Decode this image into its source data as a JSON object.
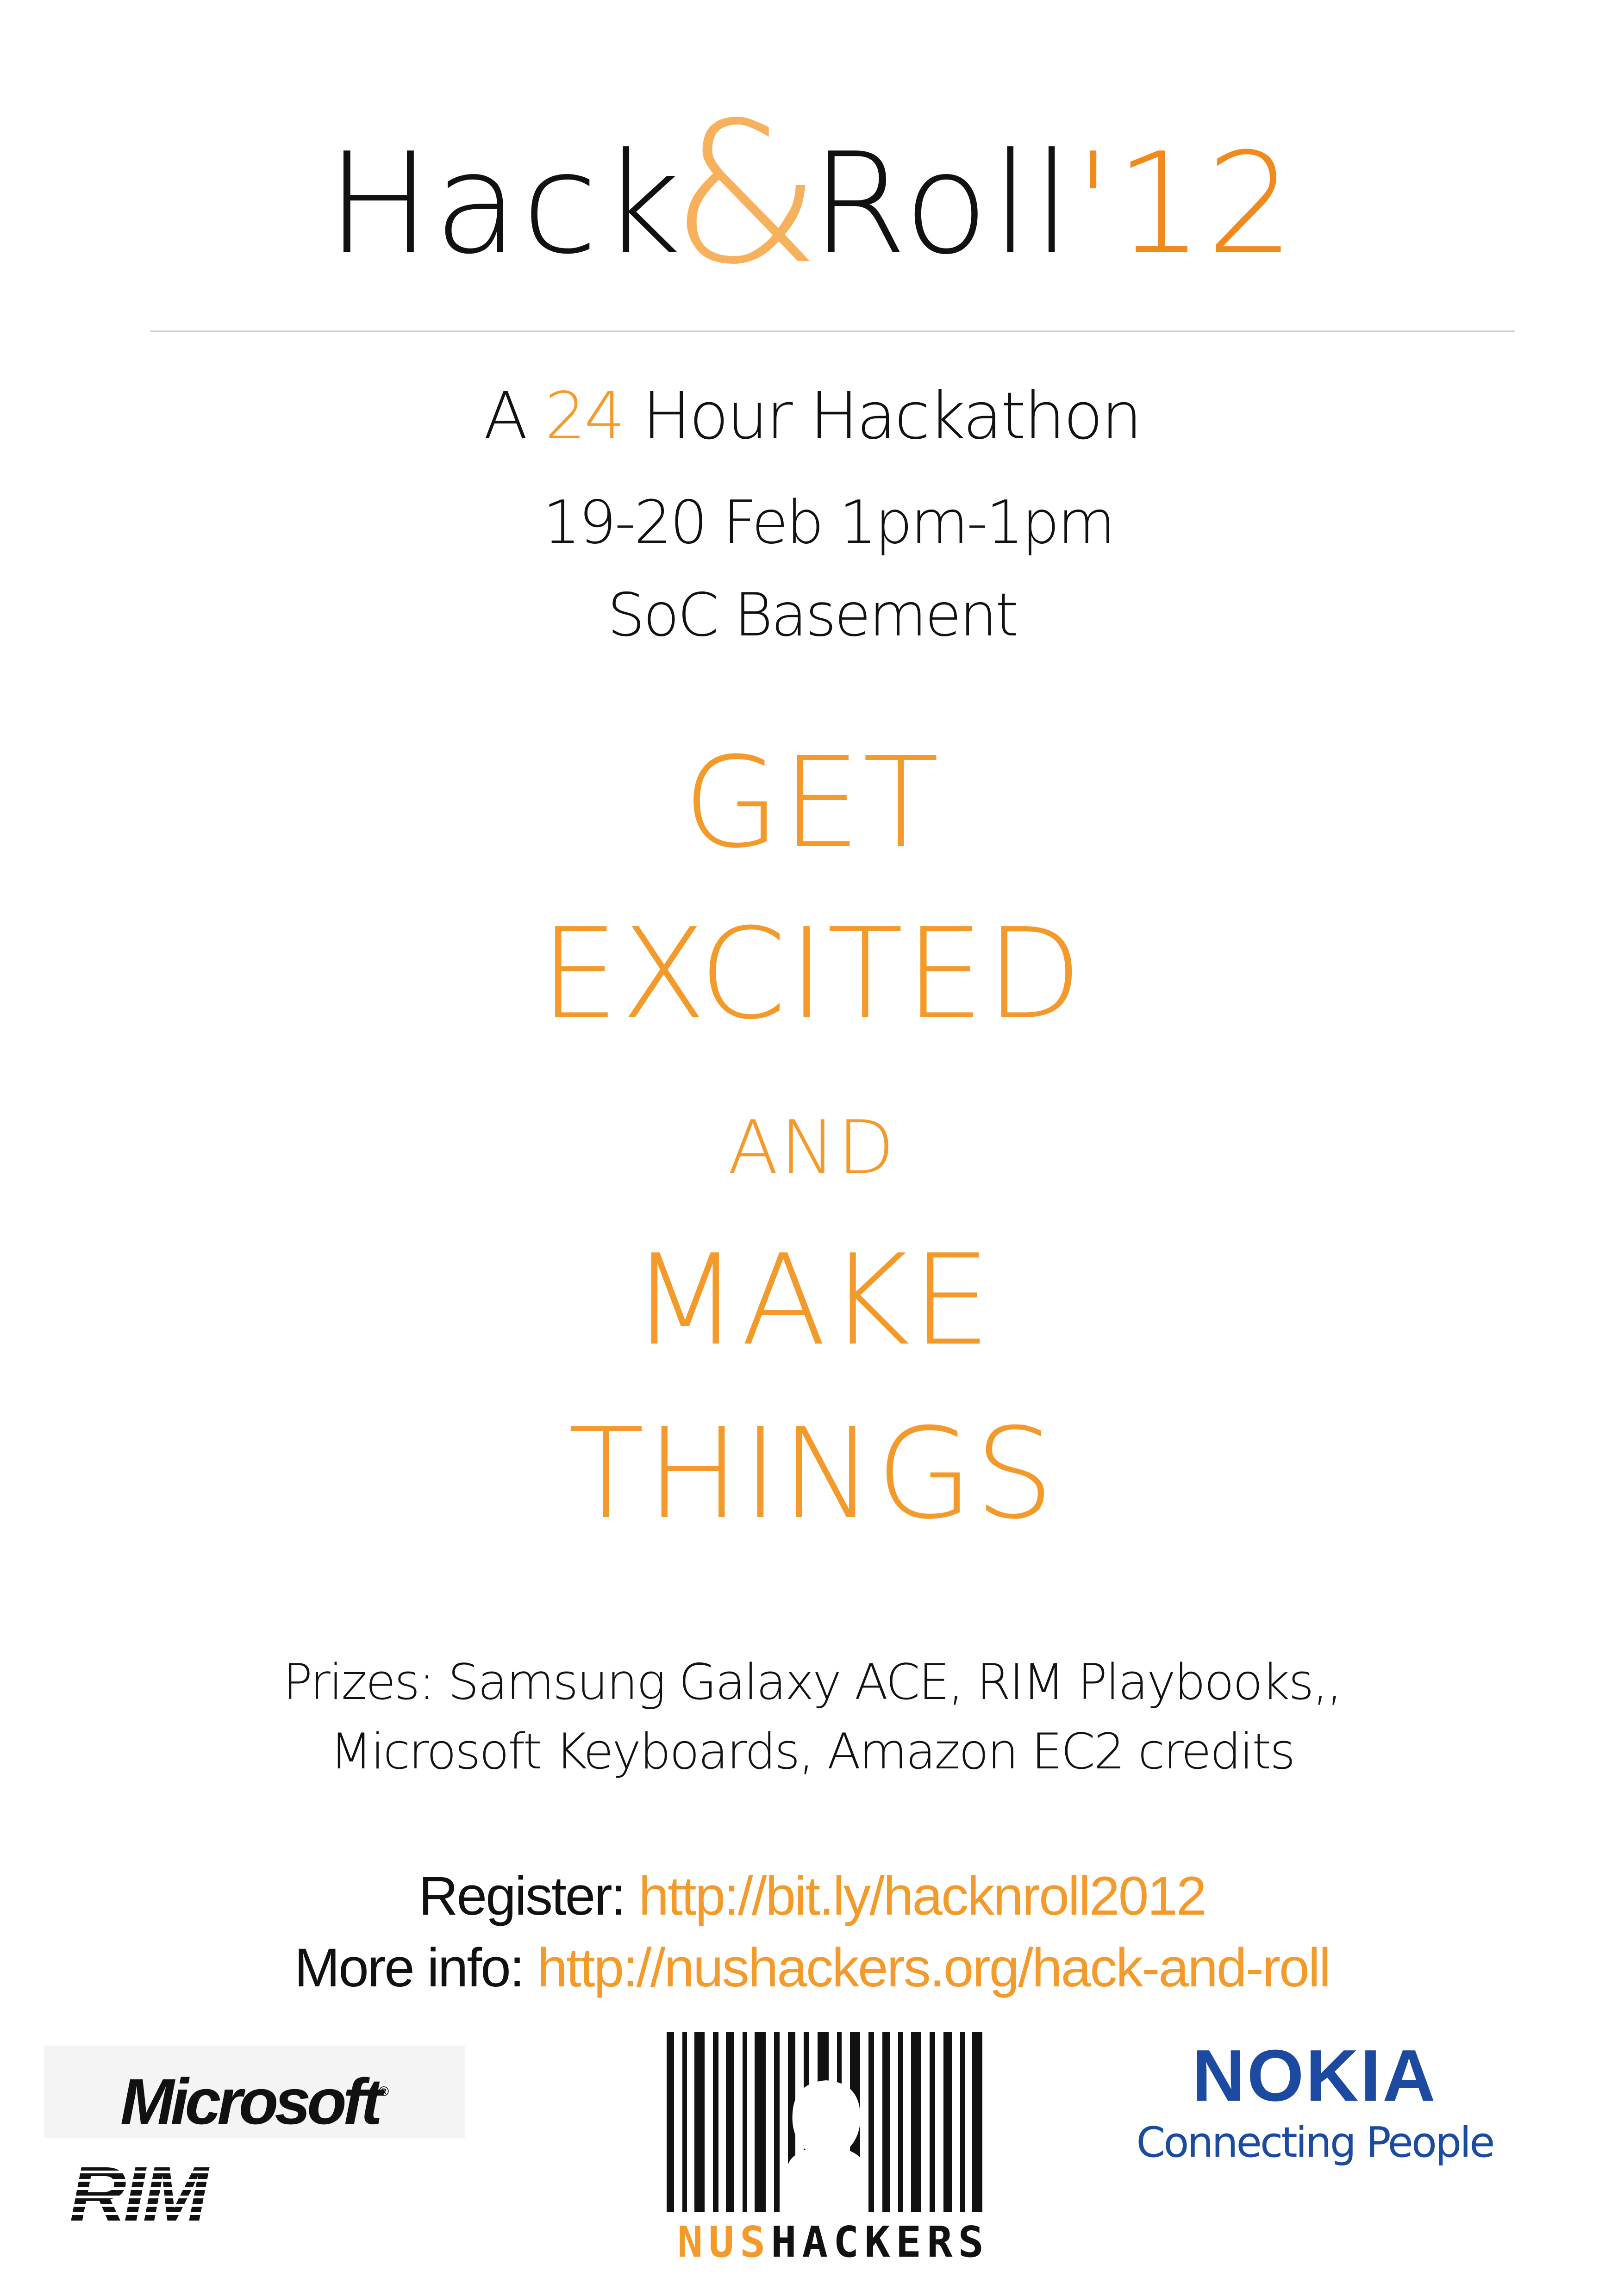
{
  "header": {
    "title_part1": "Hack",
    "title_amp": "&",
    "title_part2": "Roll",
    "title_year": "'12"
  },
  "event": {
    "line1_prefix": "A ",
    "line1_number": "24",
    "line1_suffix": " Hour Hackathon",
    "dates": "19-20 Feb 1pm-1pm",
    "venue": "SoC Basement"
  },
  "slogan": {
    "line1": "GET",
    "line2": "EXCITED",
    "line3": "AND",
    "line4": "MAKE",
    "line5": "THINGS"
  },
  "prizes": {
    "line1": "Prizes: Samsung Galaxy ACE, RIM Playbooks,,",
    "line2": "Microsoft Keyboards, Amazon EC2 credits"
  },
  "links": {
    "register_label": "Register: ",
    "register_url": "http://bit.ly/hacknroll2012",
    "info_label": "More info: ",
    "info_url": "http://nushackers.org/hack-and-roll"
  },
  "sponsors": {
    "microsoft": "Microsoft",
    "microsoft_mark": "®",
    "rim": "RIM",
    "nushackers_part1": "NUS",
    "nushackers_part2": "HACKERS",
    "nokia_brand": "NOKIA",
    "nokia_tagline": "Connecting People"
  },
  "colors": {
    "accent": "#f39a2a",
    "text": "#111111",
    "nokia_blue": "#1b4aa0"
  }
}
